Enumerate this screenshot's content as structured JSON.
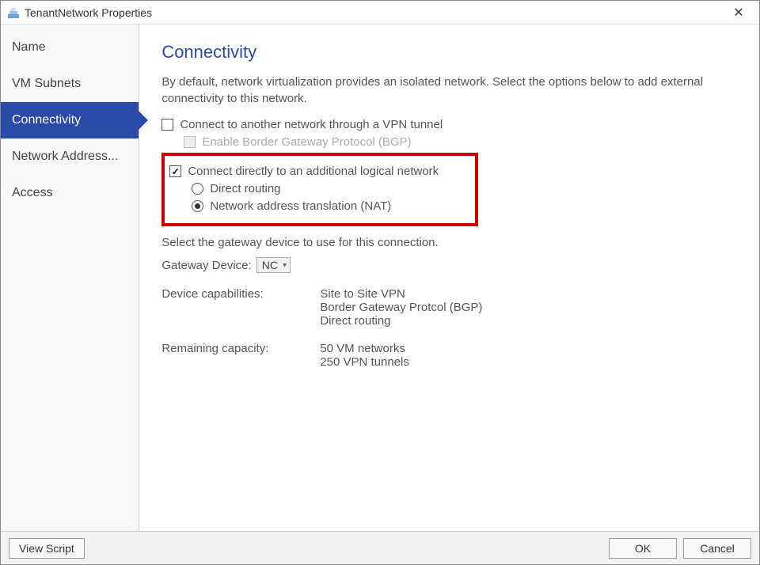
{
  "window": {
    "title": "TenantNetwork Properties"
  },
  "sidebar": {
    "items": [
      {
        "label": "Name",
        "selected": false
      },
      {
        "label": "VM Subnets",
        "selected": false
      },
      {
        "label": "Connectivity",
        "selected": true
      },
      {
        "label": "Network Address...",
        "selected": false
      },
      {
        "label": "Access",
        "selected": false
      }
    ]
  },
  "main": {
    "heading": "Connectivity",
    "description": "By default, network virtualization provides an isolated network. Select the options below to add external connectivity to this network.",
    "vpn": {
      "label": "Connect to another network through a VPN tunnel",
      "checked": false,
      "bgp": {
        "label": "Enable Border Gateway Protocol (BGP)",
        "checked": false,
        "enabled": false
      }
    },
    "direct": {
      "label": "Connect directly to an additional logical network",
      "checked": true,
      "routing_label": "Direct routing",
      "nat_label": "Network address translation (NAT)",
      "selected": "nat"
    },
    "gateway": {
      "prompt": "Select the gateway device to use for this connection.",
      "label": "Gateway Device:",
      "value": "NC"
    },
    "capabilities": {
      "label": "Device capabilities:",
      "values": [
        "Site to Site VPN",
        "Border Gateway Protcol (BGP)",
        "Direct routing"
      ]
    },
    "remaining": {
      "label": "Remaining capacity:",
      "values": [
        "50 VM networks",
        "250 VPN tunnels"
      ]
    }
  },
  "footer": {
    "view_script": "View Script",
    "ok": "OK",
    "cancel": "Cancel"
  }
}
